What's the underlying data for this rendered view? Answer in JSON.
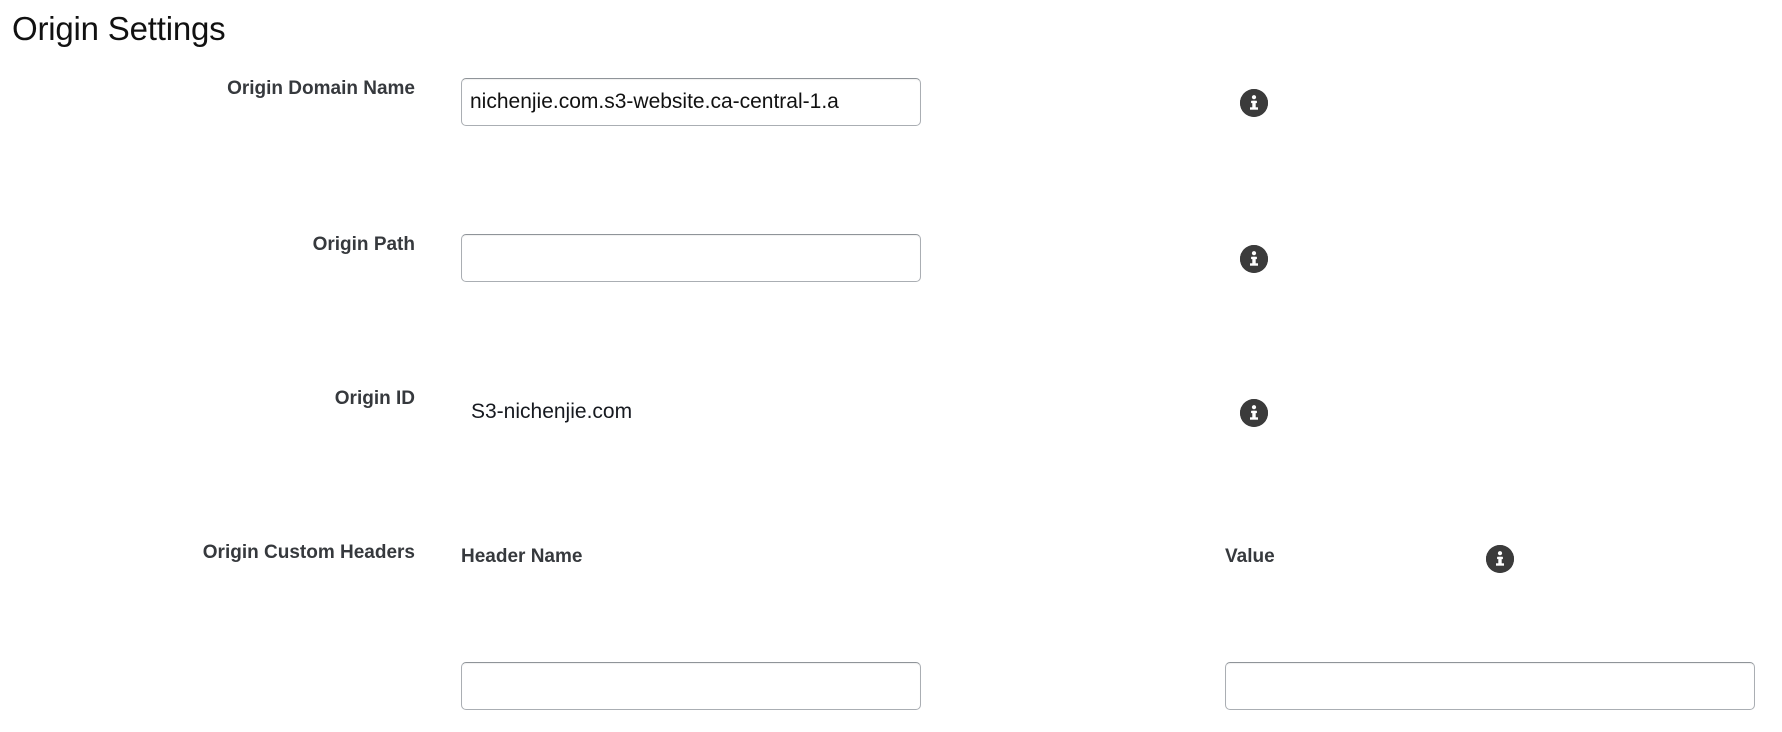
{
  "page": {
    "title": "Origin Settings"
  },
  "icons": {
    "info": "info-icon"
  },
  "fields": {
    "origin_domain_name": {
      "label": "Origin Domain Name",
      "value": "nichenjie.com.s3-website.ca-central-1.a",
      "placeholder": ""
    },
    "origin_path": {
      "label": "Origin Path",
      "value": "",
      "placeholder": ""
    },
    "origin_id": {
      "label": "Origin ID",
      "value": "S3-nichenjie.com"
    },
    "origin_custom_headers": {
      "label": "Origin Custom Headers",
      "header_name_column": "Header Name",
      "value_column": "Value",
      "header_name_value": "",
      "header_value_value": "",
      "header_name_placeholder": "",
      "header_value_placeholder": ""
    }
  },
  "colors": {
    "text": "#16191f",
    "label": "#36393d",
    "input_border": "#aaaeb3",
    "icon_fill": "#3b3b3b",
    "background": "#ffffff"
  }
}
